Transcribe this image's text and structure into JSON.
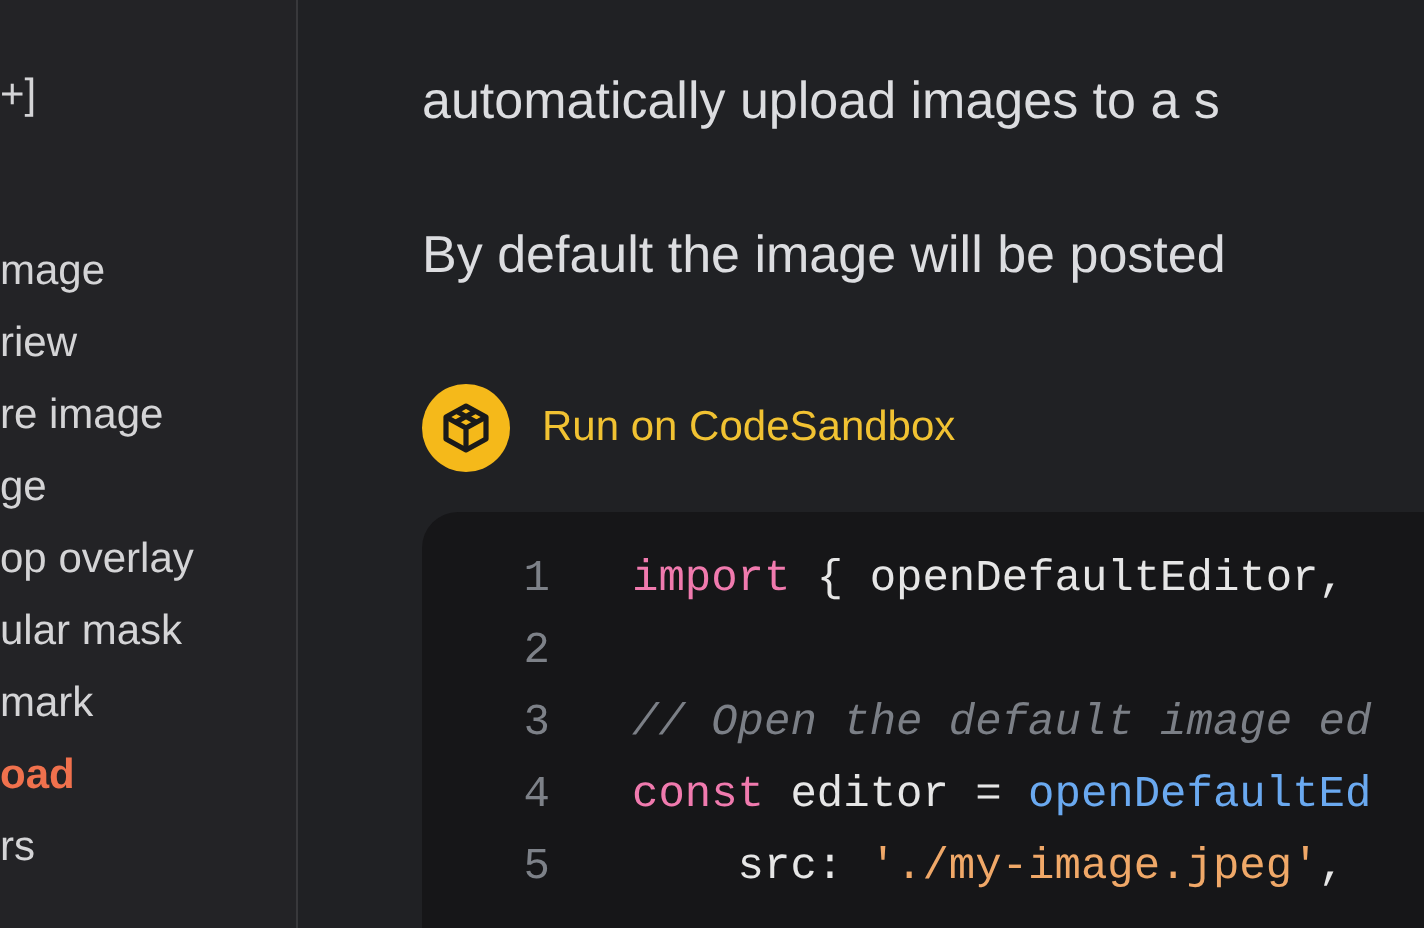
{
  "sidebar": {
    "fragments": [
      "+]"
    ],
    "items": [
      {
        "label": "mage",
        "selected": false
      },
      {
        "label": "riew",
        "selected": false
      },
      {
        "label": "re image",
        "selected": false
      },
      {
        "label": "ge",
        "selected": false
      },
      {
        "label": "op overlay",
        "selected": false
      },
      {
        "label": "ular mask",
        "selected": false
      },
      {
        "label": "mark",
        "selected": false
      },
      {
        "label": "oad",
        "selected": true
      },
      {
        "label": "rs",
        "selected": false
      }
    ]
  },
  "content": {
    "paragraphs": [
      "automatically upload images to a s",
      "By default the image will be posted"
    ],
    "run_button": {
      "label": "Run on CodeSandbox"
    },
    "code": {
      "lines": [
        {
          "number": "1",
          "tokens": [
            {
              "kind": "keyword",
              "text": "import"
            },
            {
              "kind": "plain",
              "text": " { openDefaultEditor,"
            }
          ]
        },
        {
          "number": "2"
        },
        {
          "number": "3",
          "tokens": [
            {
              "kind": "comment",
              "text": "// Open the default image ed"
            }
          ]
        },
        {
          "number": "4",
          "tokens": [
            {
              "kind": "keyword",
              "text": "const"
            },
            {
              "kind": "plain",
              "text": " editor = "
            },
            {
              "kind": "function",
              "text": "openDefaultEd"
            }
          ]
        },
        {
          "number": "5",
          "tokens": [
            {
              "kind": "plain",
              "text": "    src: "
            },
            {
              "kind": "string",
              "text": "'./my-image.jpeg'"
            },
            {
              "kind": "plain",
              "text": ","
            }
          ]
        }
      ]
    }
  }
}
